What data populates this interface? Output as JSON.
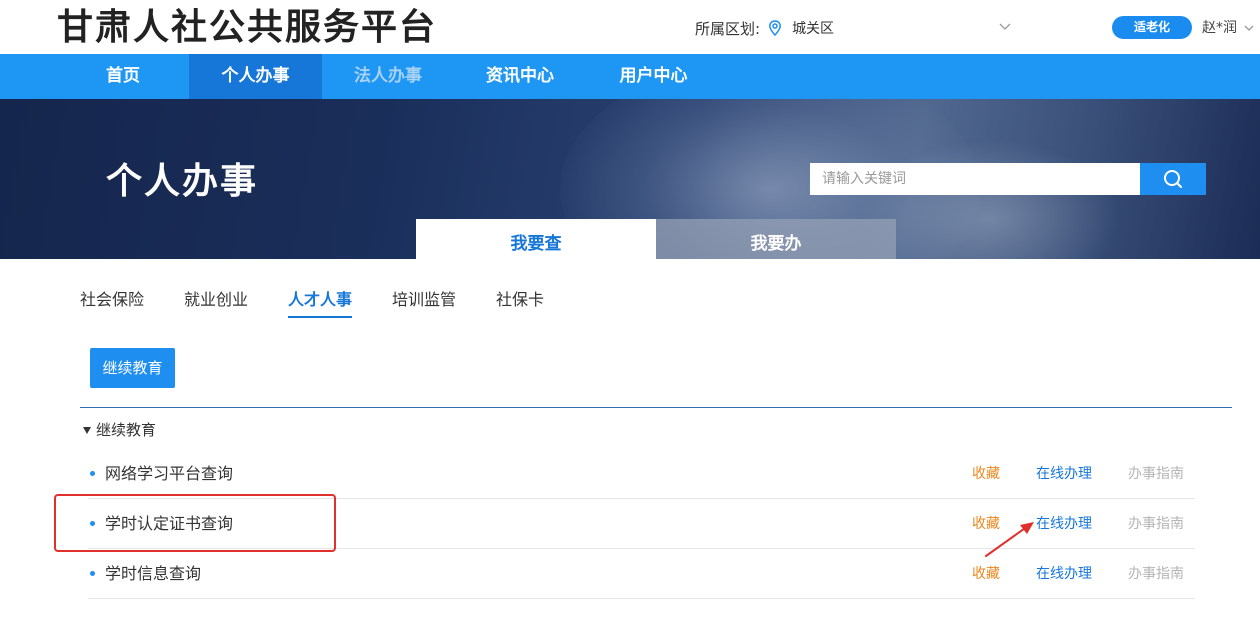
{
  "header": {
    "site_title": "甘肃人社公共服务平台",
    "region_label": "所属区划:",
    "region_value": "城关区",
    "elder_mode_label": "适老化",
    "user_name": "赵*润"
  },
  "nav": {
    "items": [
      {
        "label": "首页"
      },
      {
        "label": "个人办事"
      },
      {
        "label": "法人办事"
      },
      {
        "label": "资讯中心"
      },
      {
        "label": "用户中心"
      }
    ],
    "active": "个人办事"
  },
  "banner": {
    "title": "个人办事",
    "search_placeholder": "请输入关键词",
    "tabs": [
      {
        "label": "我要查"
      },
      {
        "label": "我要办"
      }
    ],
    "active_tab": "我要查"
  },
  "categories": {
    "items": [
      {
        "label": "社会保险"
      },
      {
        "label": "就业创业"
      },
      {
        "label": "人才人事"
      },
      {
        "label": "培训监管"
      },
      {
        "label": "社保卡"
      }
    ],
    "active": "人才人事"
  },
  "sub_category": {
    "button_label": "继续教育"
  },
  "section": {
    "title": "继续教育",
    "rows": [
      {
        "name": "网络学习平台查询",
        "favorite": "收藏",
        "online": "在线办理",
        "guide": "办事指南"
      },
      {
        "name": "学时认定证书查询",
        "favorite": "收藏",
        "online": "在线办理",
        "guide": "办事指南"
      },
      {
        "name": "学时信息查询",
        "favorite": "收藏",
        "online": "在线办理",
        "guide": "办事指南"
      }
    ]
  },
  "colors": {
    "primary": "#1e96f4",
    "nav_active": "#1677d8",
    "favorite": "#e8891e",
    "guide_disabled": "#b5b5b5",
    "annotation_red": "#e0302c"
  },
  "icons": {
    "region": "location-pin-icon",
    "search": "search-icon",
    "dropdown": "chevron-down-icon"
  }
}
